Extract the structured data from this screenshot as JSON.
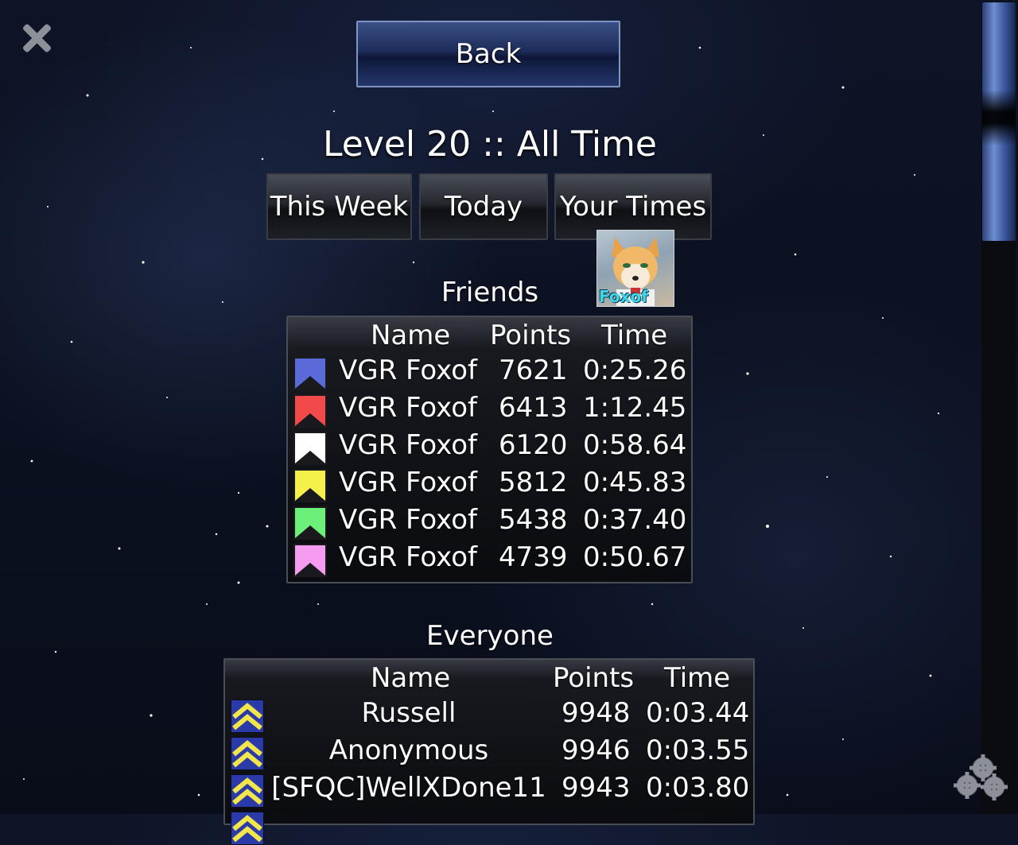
{
  "nav": {
    "back_label": "Back"
  },
  "title": "Level 20 :: All Time",
  "tabs": [
    {
      "label": "This Week"
    },
    {
      "label": "Today"
    },
    {
      "label": "Your Times"
    }
  ],
  "avatar": {
    "label": "Foxof"
  },
  "friends": {
    "title": "Friends",
    "columns": {
      "name": "Name",
      "points": "Points",
      "time": "Time"
    },
    "rows": [
      {
        "name": "VGR Foxof",
        "points": "7621",
        "time": "0:25.26",
        "flag_color": "#5a6ad8"
      },
      {
        "name": "VGR Foxof",
        "points": "6413",
        "time": "1:12.45",
        "flag_color": "#f24a4a"
      },
      {
        "name": "VGR Foxof",
        "points": "6120",
        "time": "0:58.64",
        "flag_color": "#ffffff"
      },
      {
        "name": "VGR Foxof",
        "points": "5812",
        "time": "0:45.83",
        "flag_color": "#f6f04a"
      },
      {
        "name": "VGR Foxof",
        "points": "5438",
        "time": "0:37.40",
        "flag_color": "#6cf07a"
      },
      {
        "name": "VGR Foxof",
        "points": "4739",
        "time": "0:50.67",
        "flag_color": "#f59cf0"
      }
    ]
  },
  "everyone": {
    "title": "Everyone",
    "columns": {
      "name": "Name",
      "points": "Points",
      "time": "Time"
    },
    "rows": [
      {
        "name": "Russell",
        "points": "9948",
        "time": "0:03.44"
      },
      {
        "name": "Anonymous",
        "points": "9946",
        "time": "0:03.55"
      },
      {
        "name": "[SFQC]WellXDone11",
        "points": "9943",
        "time": "0:03.80"
      }
    ],
    "rank_icon_colors": {
      "chevron": "#f2e64a",
      "background": "#2a3aa8"
    }
  },
  "icons": {
    "close": "close-icon",
    "settings": "gears-icon",
    "flag": "chevron-flag-icon"
  }
}
